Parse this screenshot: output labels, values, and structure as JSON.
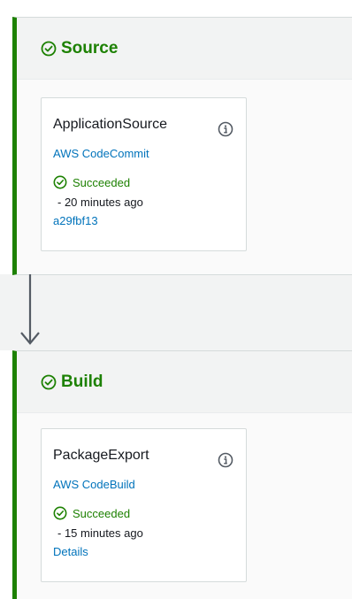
{
  "colors": {
    "success": "#1d8102",
    "link": "#0073bb",
    "text": "#16191f",
    "border": "#d5dbdb",
    "header_bg": "#f2f3f3"
  },
  "stages": [
    {
      "title": "Source",
      "status_icon": "check-circle-icon",
      "action": {
        "name": "ApplicationSource",
        "info_icon": "info-icon",
        "provider": "AWS CodeCommit",
        "status": "Succeeded",
        "time": "- 20 minutes ago",
        "extra_link": "a29fbf13"
      }
    },
    {
      "title": "Build",
      "status_icon": "check-circle-icon",
      "action": {
        "name": "PackageExport",
        "info_icon": "info-icon",
        "provider": "AWS CodeBuild",
        "status": "Succeeded",
        "time": "- 15 minutes ago",
        "extra_link": "Details"
      }
    }
  ],
  "transition_icon": "arrow-down-icon"
}
